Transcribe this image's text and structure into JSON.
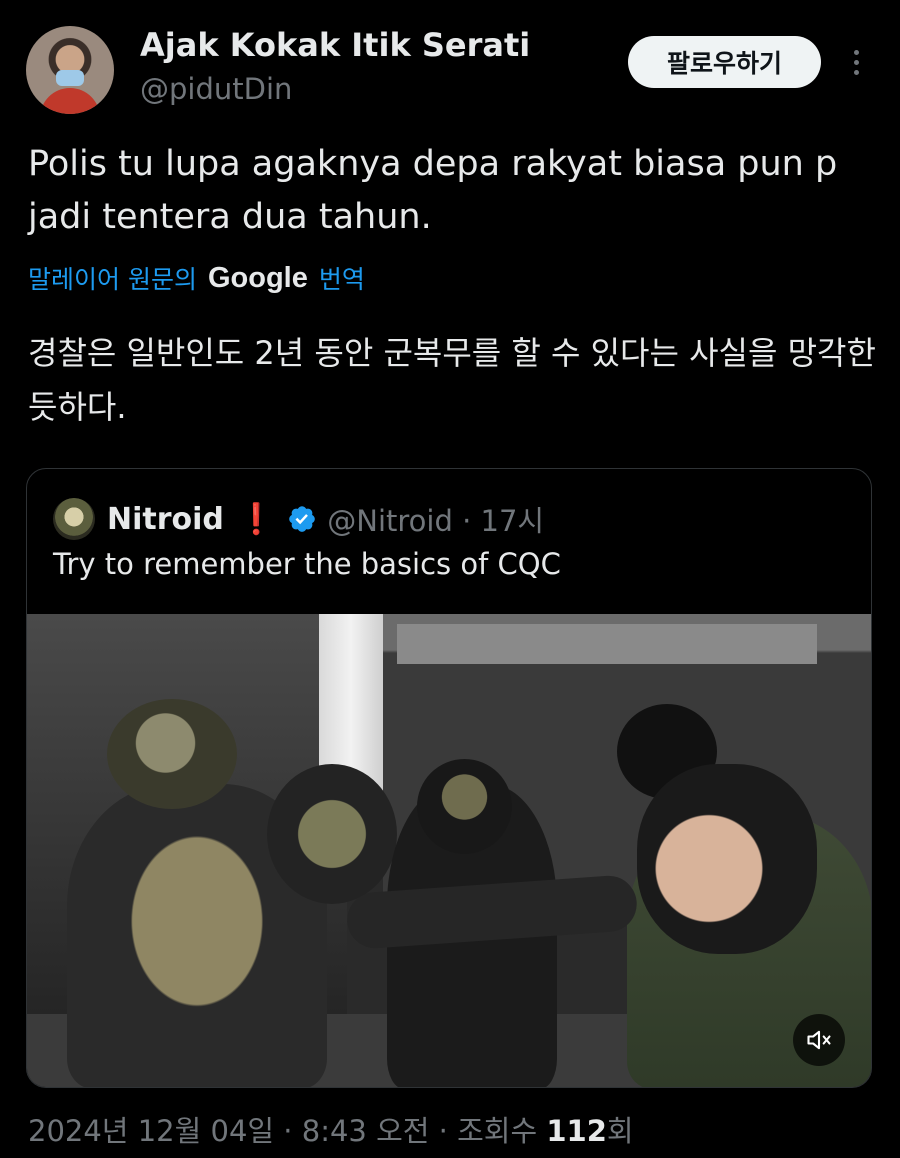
{
  "author": {
    "name": "Ajak Kokak Itik Serati",
    "handle": "@pidutDin",
    "avatar_icon": "profile-photo"
  },
  "actions": {
    "follow_label": "팔로우하기",
    "more_icon": "more-vertical-icon"
  },
  "tweet": {
    "text": "Polis tu lupa agaknya depa rakyat biasa pun p jadi tentera dua tahun.",
    "translation_prefix": "말레이어 원문의",
    "translation_brand": "Google",
    "translation_suffix": "번역",
    "translated_text": "경찰은 일반인도 2년 동안 군복무를 할 수 있다는 사실을 망각한 듯하다."
  },
  "quote": {
    "name": "Nitroid",
    "exclamation": "❗",
    "verified": true,
    "handle_time": "@Nitroid · 17시",
    "text": "Try to remember the basics of CQC",
    "media_type": "video",
    "mute_icon": "volume-muted-icon"
  },
  "meta": {
    "date_time": "2024년 12월 04일 · 8:43 오전 · 조회수 ",
    "views": "112",
    "views_suffix": "회"
  },
  "colors": {
    "background": "#000000",
    "text": "#e7e9ea",
    "secondary": "#71767b",
    "link": "#1d9bf0",
    "verified": "#1d9bf0",
    "border": "#2f3336"
  }
}
